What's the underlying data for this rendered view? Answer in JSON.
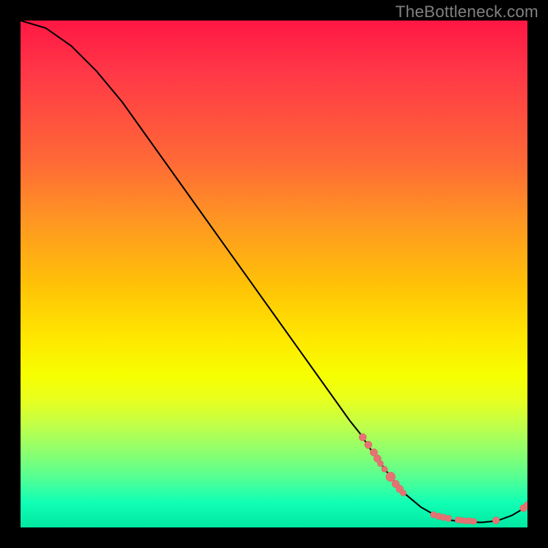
{
  "watermark": "TheBottleneck.com",
  "colors": {
    "dot_fill": "#e57373",
    "dot_stroke": "#d4675f",
    "curve": "#000000",
    "background": "#000000",
    "watermark_text": "#808080"
  },
  "chart_data": {
    "type": "line",
    "title": "",
    "xlabel": "",
    "ylabel": "",
    "xlim": [
      0,
      100
    ],
    "ylim": [
      0,
      100
    ],
    "grid": false,
    "legend": false,
    "series": [
      {
        "name": "curve",
        "x": [
          0,
          5,
          10,
          15,
          20,
          25,
          30,
          35,
          40,
          45,
          50,
          55,
          60,
          65,
          67,
          70,
          73,
          76,
          79,
          82,
          85,
          88,
          91,
          94,
          97,
          100
        ],
        "y": [
          100,
          98.5,
          95,
          90,
          84,
          77,
          70,
          63,
          56,
          49,
          42,
          35,
          28,
          21,
          18.5,
          14,
          10,
          6.5,
          4,
          2.3,
          1.4,
          1.1,
          1.0,
          1.3,
          2.4,
          4.2
        ]
      }
    ],
    "markers": [
      {
        "x": 67.5,
        "y": 17.8,
        "r": 5.5
      },
      {
        "x": 68.6,
        "y": 16.3,
        "r": 5.5
      },
      {
        "x": 69.7,
        "y": 14.8,
        "r": 5.5
      },
      {
        "x": 70.4,
        "y": 13.6,
        "r": 5.5
      },
      {
        "x": 71.0,
        "y": 12.6,
        "r": 4.5
      },
      {
        "x": 71.8,
        "y": 11.5,
        "r": 4.5
      },
      {
        "x": 73.0,
        "y": 10.0,
        "r": 7.0
      },
      {
        "x": 74.0,
        "y": 8.6,
        "r": 5.5
      },
      {
        "x": 74.8,
        "y": 7.6,
        "r": 5.5
      },
      {
        "x": 75.5,
        "y": 6.8,
        "r": 4.5
      },
      {
        "x": 81.5,
        "y": 2.5,
        "r": 4.8
      },
      {
        "x": 82.5,
        "y": 2.2,
        "r": 4.8
      },
      {
        "x": 83.4,
        "y": 2.0,
        "r": 4.8
      },
      {
        "x": 84.4,
        "y": 1.8,
        "r": 4.8
      },
      {
        "x": 86.3,
        "y": 1.5,
        "r": 4.5
      },
      {
        "x": 87.0,
        "y": 1.4,
        "r": 4.5
      },
      {
        "x": 87.8,
        "y": 1.3,
        "r": 4.5
      },
      {
        "x": 88.6,
        "y": 1.3,
        "r": 4.5
      },
      {
        "x": 89.4,
        "y": 1.2,
        "r": 4.5
      },
      {
        "x": 93.8,
        "y": 1.4,
        "r": 5.2
      },
      {
        "x": 99.2,
        "y": 3.8,
        "r": 5.2
      },
      {
        "x": 100.0,
        "y": 4.4,
        "r": 5.2
      }
    ]
  }
}
